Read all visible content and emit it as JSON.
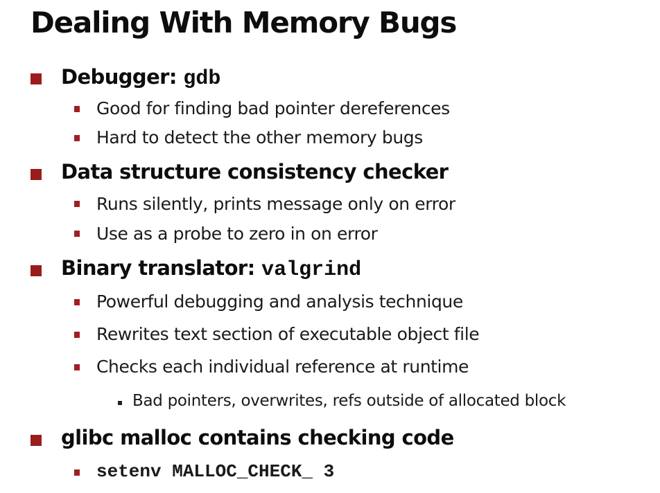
{
  "slide": {
    "title": "Dealing With Memory Bugs",
    "items": [
      {
        "label": "Debugger: ",
        "code": "gdb",
        "subitems": [
          {
            "text": "Good for finding  bad pointer dereferences"
          },
          {
            "text": "Hard to detect the other memory bugs"
          }
        ]
      },
      {
        "label": "Data structure consistency checker",
        "subitems": [
          {
            "text": " Runs silently, prints message only on error"
          },
          {
            "text": "Use as a probe to zero in on error"
          }
        ]
      },
      {
        "label": "Binary translator:  ",
        "code": "valgrind",
        "subitems": [
          {
            "text": "Powerful debugging and analysis technique"
          },
          {
            "text": "Rewrites text section of executable object file"
          },
          {
            "text": "Checks each individual reference at runtime",
            "subitems": [
              {
                "text": "Bad pointers, overwrites, refs outside of allocated block"
              }
            ]
          }
        ]
      },
      {
        "label": "glibc malloc contains checking code",
        "subitems": [
          {
            "code": "setenv MALLOC_CHECK_ 3"
          }
        ]
      }
    ]
  },
  "colors": {
    "bullet_level1": "#9b1c1c",
    "bullet_level2": "#a31d24",
    "bullet_level3": "#222222",
    "text": "#111111",
    "background": "#ffffff"
  }
}
